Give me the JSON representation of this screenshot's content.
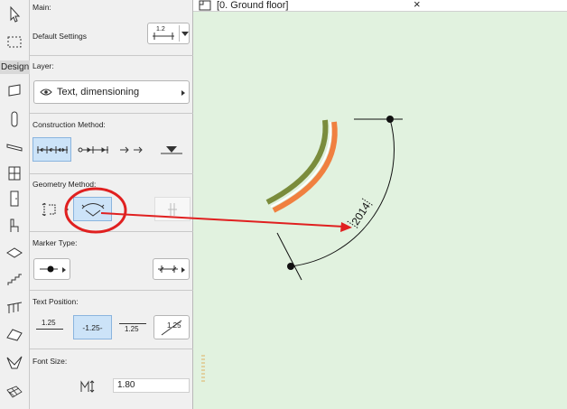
{
  "toolbox": {
    "design_label": "Design",
    "tools": [
      "arrow-tool",
      "marquee-tool",
      "wall-tool",
      "column-tool",
      "beam-tool",
      "window-tool",
      "door-tool",
      "object-tool",
      "zone-tool",
      "stair-tool",
      "railing-tool",
      "roof-tool",
      "shell-tool",
      "mesh-tool"
    ]
  },
  "panel": {
    "main": {
      "title": "Main:",
      "default_settings_label": "Default Settings",
      "dim_icon_text": "1.2"
    },
    "layer": {
      "title": "Layer:",
      "value": "Text, dimensioning"
    },
    "construction": {
      "title": "Construction Method:"
    },
    "geometry": {
      "title": "Geometry Method:"
    },
    "marker": {
      "title": "Marker Type:"
    },
    "text_position": {
      "title": "Text Position:",
      "options": [
        "1.25",
        "-1.25-",
        "1.25",
        "1.25"
      ]
    },
    "font_size": {
      "title": "Font Size:",
      "value": "1.80"
    }
  },
  "tab": {
    "title": "[0. Ground floor]",
    "close_glyph": "×"
  },
  "drawing": {
    "dimension_text": "2014"
  },
  "colors": {
    "canvas_bg": "#e1f2df",
    "annotation_red": "#e02020",
    "wall_olive": "#7a8c3c",
    "wall_orange": "#f08040",
    "selected_blue": "#cce3f8"
  }
}
